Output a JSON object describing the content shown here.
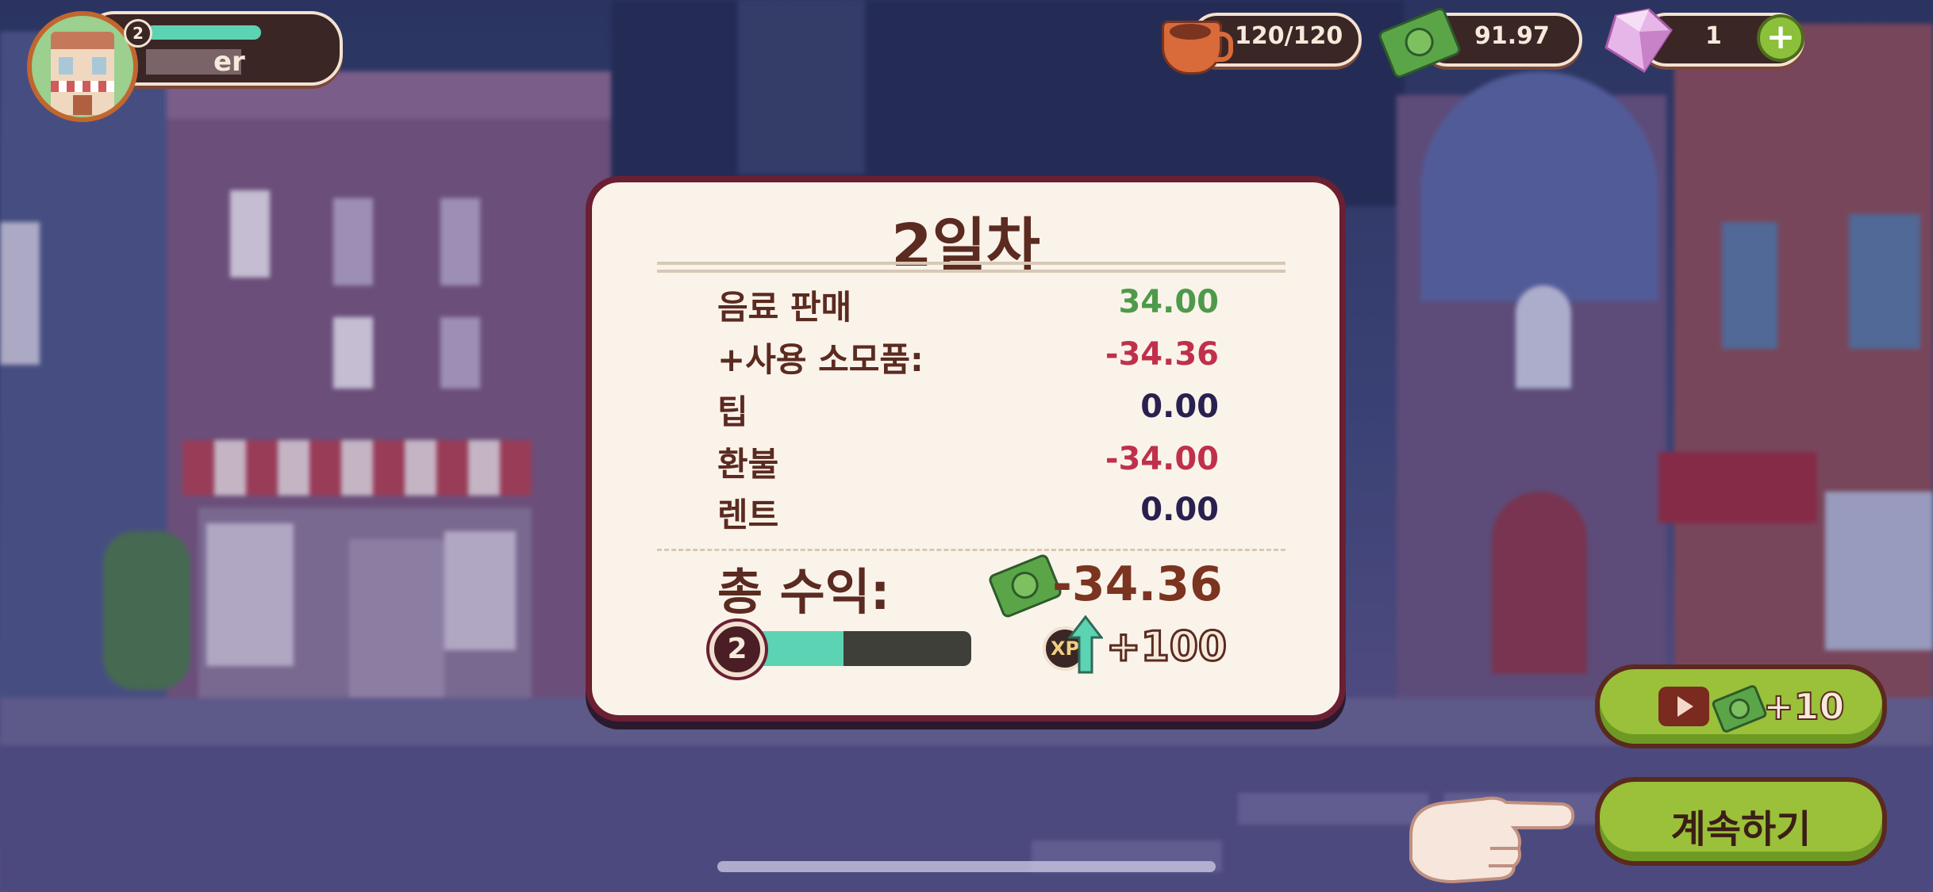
{
  "player": {
    "level": "2",
    "name": "er",
    "colors": {
      "xp_fill": "#5cd3b3"
    }
  },
  "hud": {
    "energy": {
      "icon": "coffee-cup-icon",
      "value": "120/120"
    },
    "cash": {
      "icon": "cash-icon",
      "value": "91.97"
    },
    "gems": {
      "icon": "gem-icon",
      "value": "1",
      "add_icon": "plus-icon"
    }
  },
  "summary": {
    "title": "2일차",
    "rows": [
      {
        "label": "음료 판매",
        "value": "34.00",
        "color": "#4e9a4a"
      },
      {
        "label": "+사용 소모품:",
        "value": "-34.36",
        "color": "#c0304a"
      },
      {
        "label": "팁",
        "value": "0.00",
        "color": "#2a2050"
      },
      {
        "label": "환불",
        "value": "-34.00",
        "color": "#c0304a"
      },
      {
        "label": "렌트",
        "value": "0.00",
        "color": "#2a2050"
      }
    ],
    "total_label": "총 수익:",
    "total_value": "-34.36",
    "total_icon": "cash-icon",
    "level_badge": "2",
    "xp_progress": 0.48,
    "xp_badge": "XP",
    "xp_gain": "+100"
  },
  "buttons": {
    "ad_reward": {
      "icon": "video-play-icon",
      "reward_icon": "cash-icon",
      "label": "+10"
    },
    "continue": {
      "label": "계속하기"
    }
  },
  "colors": {
    "dialog_border": "#6b1f33",
    "button_green": "#9bc03a"
  }
}
